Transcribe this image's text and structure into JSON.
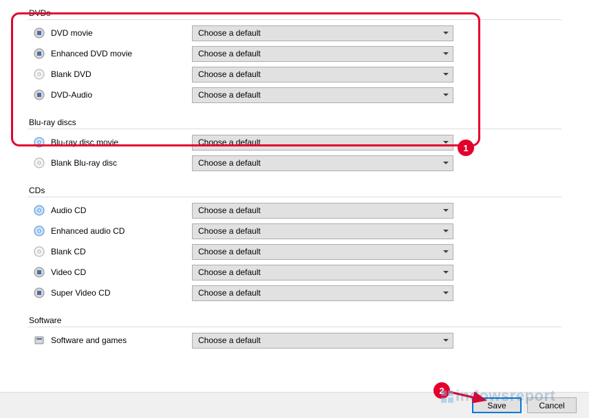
{
  "default_text": "Choose a default",
  "sections": {
    "dvds": {
      "title": "DVDs",
      "items": [
        {
          "label": "DVD movie",
          "icon": "dvd-media-icon"
        },
        {
          "label": "Enhanced DVD movie",
          "icon": "dvd-media-icon"
        },
        {
          "label": "Blank DVD",
          "icon": "disc-blank-icon"
        },
        {
          "label": "DVD-Audio",
          "icon": "dvd-media-icon"
        }
      ]
    },
    "bluray": {
      "title": "Blu-ray discs",
      "items": [
        {
          "label": "Blu-ray disc movie",
          "icon": "bluray-icon"
        },
        {
          "label": "Blank Blu-ray disc",
          "icon": "disc-blank-icon"
        }
      ]
    },
    "cds": {
      "title": "CDs",
      "items": [
        {
          "label": "Audio CD",
          "icon": "cd-audio-icon"
        },
        {
          "label": "Enhanced audio CD",
          "icon": "cd-audio-icon"
        },
        {
          "label": "Blank CD",
          "icon": "disc-blank-icon"
        },
        {
          "label": "Video CD",
          "icon": "dvd-media-icon"
        },
        {
          "label": "Super Video CD",
          "icon": "dvd-media-icon"
        }
      ]
    },
    "software": {
      "title": "Software",
      "items": [
        {
          "label": "Software and games",
          "icon": "software-icon"
        }
      ]
    }
  },
  "footer": {
    "save": "Save",
    "cancel": "Cancel"
  },
  "annotations": {
    "badge1": "1",
    "badge2": "2"
  },
  "watermark": "indowsreport"
}
